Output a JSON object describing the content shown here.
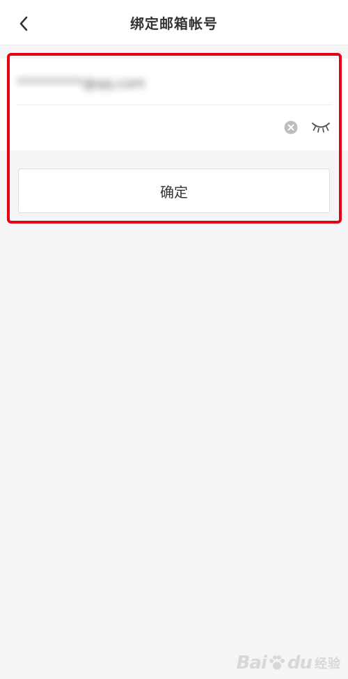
{
  "header": {
    "title": "绑定邮箱帐号",
    "back_icon": "chevron-left-icon"
  },
  "form": {
    "email_value": "**********@qq.com",
    "password_value": "",
    "clear_icon": "clear-icon",
    "visibility_icon": "eye-closed-icon"
  },
  "actions": {
    "confirm_label": "确定"
  },
  "watermark": {
    "text_left": "Bai",
    "text_right": "du",
    "sub": "经验"
  },
  "colors": {
    "highlight": "#e60012",
    "background": "#f5f5f7",
    "text": "#333333"
  }
}
